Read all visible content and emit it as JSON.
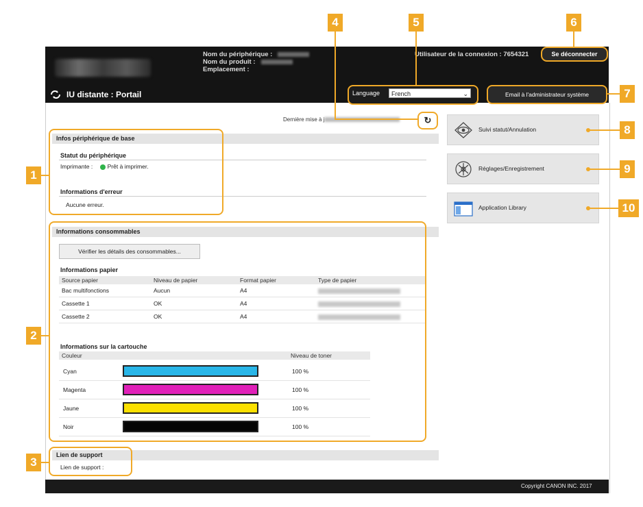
{
  "header": {
    "device_name_label": "Nom du périphérique :",
    "product_name_label": "Nom du produit :",
    "location_label": "Emplacement :",
    "user_label": "Utilisateur de la connexion :  7654321",
    "logout_label": "Se déconnecter",
    "title": "IU distante : Portail",
    "language_label": "Language",
    "language_value": "French",
    "email_admin_label": "Email à l'administrateur système"
  },
  "last_update_label": "Dernière mise à j",
  "basic_info": {
    "title": "Infos périphérique de base",
    "device_status_title": "Statut du périphérique",
    "printer_label": "Imprimante :",
    "printer_status": "Prêt à imprimer.",
    "error_title": "Informations d'erreur",
    "error_value": "Aucune erreur."
  },
  "consumables": {
    "title": "Informations consommables",
    "check_button": "Vérifier les détails des consommables...",
    "paper_title": "Informations papier",
    "paper_columns": [
      "Source papier",
      "Niveau de papier",
      "Format papier",
      "Type de papier"
    ],
    "paper_rows": [
      {
        "source": "Bac multifonctions",
        "level": "Aucun",
        "format": "A4"
      },
      {
        "source": "Cassette 1",
        "level": "OK",
        "format": "A4"
      },
      {
        "source": "Cassette 2",
        "level": "OK",
        "format": "A4"
      }
    ],
    "cartridge_title": "Informations sur la cartouche",
    "cartridge_columns": [
      "Couleur",
      "Niveau de toner"
    ],
    "cartridge_rows": [
      {
        "color": "Cyan",
        "level": "100 %",
        "hex": "#29b6e8"
      },
      {
        "color": "Magenta",
        "level": "100 %",
        "hex": "#e020b8"
      },
      {
        "color": "Jaune",
        "level": "100 %",
        "hex": "#fbe000"
      },
      {
        "color": "Noir",
        "level": "100 %",
        "hex": "#050505"
      }
    ]
  },
  "support": {
    "title": "Lien de support",
    "link_label": "Lien de support :"
  },
  "side_menu": [
    {
      "label": "Suivi statut/Annulation",
      "icon": "eye-icon"
    },
    {
      "label": "Réglages/Enregistrement",
      "icon": "settings-icon"
    },
    {
      "label": "Application Library",
      "icon": "window-icon"
    }
  ],
  "callouts": [
    "1",
    "2",
    "3",
    "4",
    "5",
    "6",
    "7",
    "8",
    "9",
    "10"
  ],
  "footer": {
    "copyright": "Copyright CANON INC. 2017"
  },
  "colors": {
    "callout": "#f0a928",
    "header_bg": "#141414",
    "status_ok": "#2fb34a"
  }
}
